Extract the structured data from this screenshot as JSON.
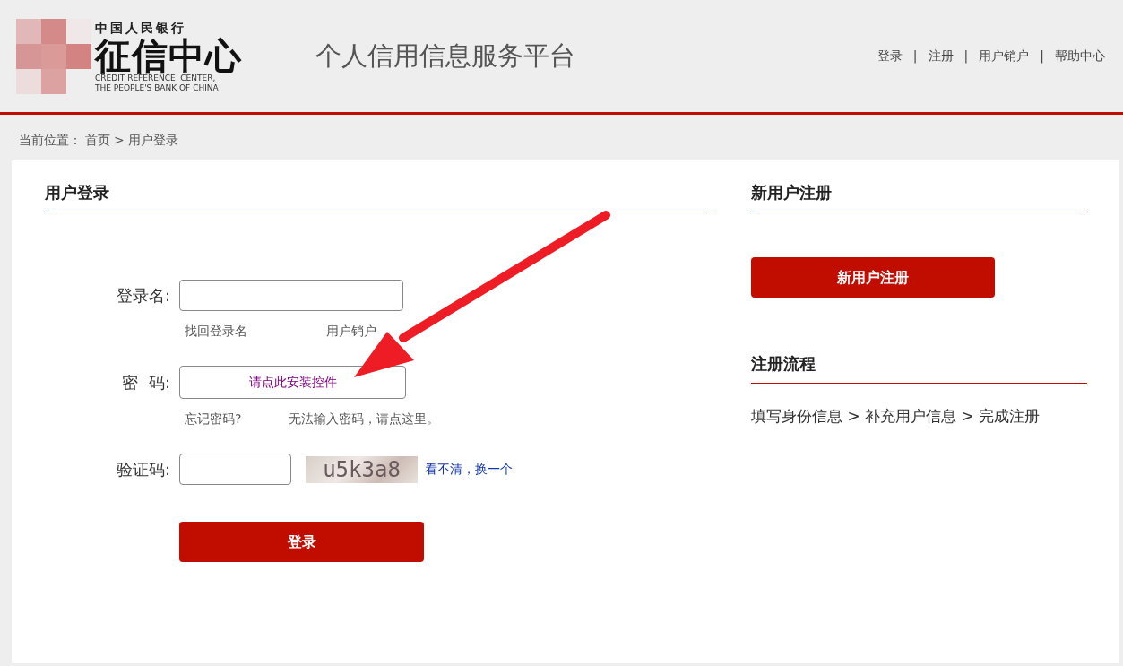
{
  "header": {
    "logo": {
      "top_line": "中国人民银行",
      "name": "征信中心",
      "english_lines": [
        "CREDIT REFERENCE  CENTER,",
        "THE PEOPLE'S BANK OF CHINA"
      ]
    },
    "title": "个人信用信息服务平台",
    "nav": [
      {
        "kind": "link",
        "label": "登录"
      },
      {
        "kind": "separator",
        "label": "|"
      },
      {
        "kind": "link",
        "label": "注册"
      },
      {
        "kind": "separator",
        "label": "|"
      },
      {
        "kind": "link",
        "label": "用户销户"
      },
      {
        "kind": "separator",
        "label": "|"
      },
      {
        "kind": "link",
        "label": "帮助中心"
      }
    ]
  },
  "breadcrumb": {
    "label": "当前位置：",
    "items": [
      "首页",
      "用户登录"
    ],
    "separator": ">"
  },
  "login": {
    "heading": "用户登录",
    "fields": [
      {
        "kind": "text",
        "label": "登录名:",
        "links": [
          "找回登录名",
          "用户销户"
        ]
      },
      {
        "kind": "control",
        "label": "密  码:",
        "control_text": "请点此安装控件",
        "links": [
          "忘记密码?",
          "无法输入密码，请点这里。"
        ]
      },
      {
        "kind": "captcha",
        "label": "验证码:",
        "captcha": "u5k3a8",
        "refresh": "看不清，换一个"
      }
    ],
    "submit": "登录"
  },
  "register": {
    "heading": "新用户注册",
    "button": "新用户注册",
    "process_heading": "注册流程",
    "process": "填写身份信息 > 补充用户信息 > 完成注册"
  },
  "annotation": {
    "kind": "arrow"
  }
}
